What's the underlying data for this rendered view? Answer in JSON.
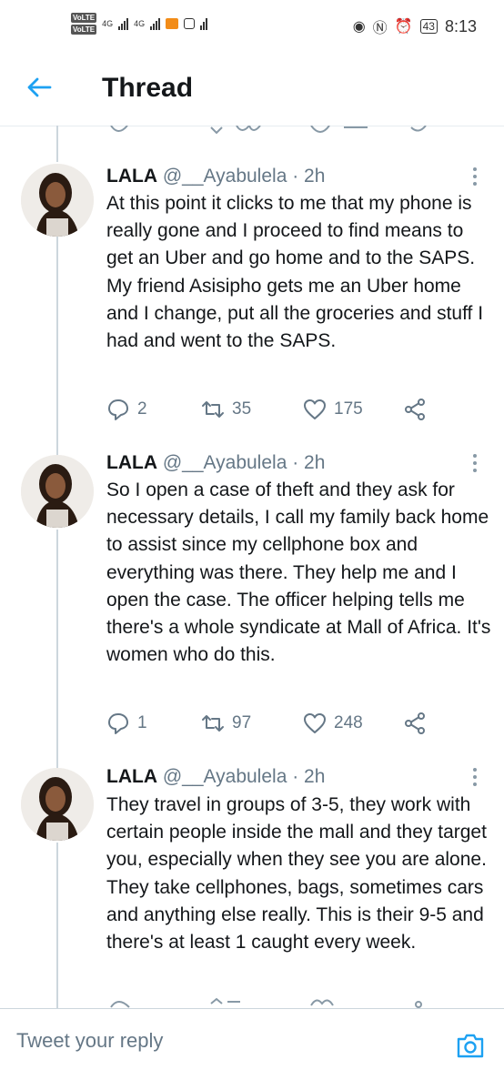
{
  "status_bar": {
    "volte_1": "VoLTE",
    "volte_2": "VoLTE",
    "network_1": "4G",
    "network_2": "4G",
    "battery": "43",
    "time": "8:13"
  },
  "header": {
    "title": "Thread"
  },
  "tweets": [
    {
      "name": "LALA",
      "handle": "@__Ayabulela",
      "time": "· 2h",
      "text": "At this point it clicks to me that my phone is really gone and I proceed to find means to get an Uber and go home and to the SAPS. My friend Asisipho gets me an Uber home and I change, put all the groceries and stuff I had and went to the SAPS.",
      "replies": "2",
      "retweets": "35",
      "likes": "175"
    },
    {
      "name": "LALA",
      "handle": "@__Ayabulela",
      "time": "· 2h",
      "text": "So I open a case of theft and they ask for necessary details, I call my family back home to assist since my cellphone box and everything was there. They help me and I open the case. The officer helping tells me there's a whole syndicate at Mall of Africa. It's women who do this.",
      "replies": "1",
      "retweets": "97",
      "likes": "248"
    },
    {
      "name": "LALA",
      "handle": "@__Ayabulela",
      "time": "· 2h",
      "text": "They travel in groups of 3-5, they work with certain people inside the mall and they target you, especially when they see you are alone. They take cellphones, bags, sometimes cars and anything else really. This is their 9-5 and there's at least 1 caught every week."
    }
  ],
  "reply_bar": {
    "placeholder": "Tweet your reply"
  },
  "colors": {
    "accent": "#1da1f2",
    "muted": "#657786",
    "text": "#14171a"
  },
  "icons": [
    "back-arrow-icon",
    "more-vertical-icon",
    "reply-icon",
    "retweet-icon",
    "like-icon",
    "share-icon",
    "camera-icon"
  ]
}
